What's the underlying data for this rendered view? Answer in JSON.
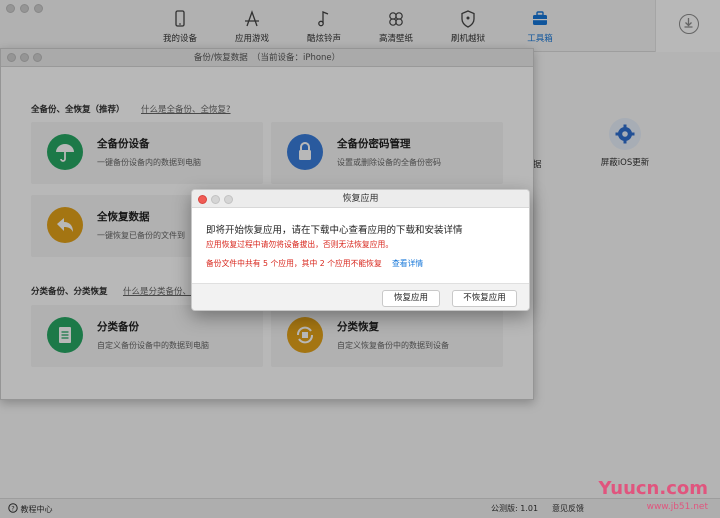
{
  "nav": {
    "tabs": [
      {
        "label": "我的设备",
        "icon": "phone-icon"
      },
      {
        "label": "应用游戏",
        "icon": "app-store-icon"
      },
      {
        "label": "酷炫铃声",
        "icon": "music-note-icon"
      },
      {
        "label": "高清壁纸",
        "icon": "flower-icon"
      },
      {
        "label": "刷机越狱",
        "icon": "shield-icon"
      },
      {
        "label": "工具箱",
        "icon": "toolbox-icon"
      }
    ],
    "active_index": 5,
    "download_icon": "download-icon"
  },
  "behind": {
    "ios_update_label": "屏蔽iOS更新",
    "partial_label": "据"
  },
  "backup_window": {
    "title": "备份/恢复数据　（当前设备：iPhone）",
    "section1": {
      "title": "全备份、全恢复（推荐）",
      "link": "什么是全备份、全恢复?"
    },
    "cards1": [
      {
        "title": "全备份设备",
        "desc": "一键备份设备内的数据到电脑",
        "icon": "umbrella-icon",
        "color": "#27a865"
      },
      {
        "title": "全备份密码管理",
        "desc": "设置或删除设备的全备份密码",
        "icon": "lock-icon",
        "color": "#3a7ddb"
      },
      {
        "title": "全恢复数据",
        "desc": "一键恢复已备份的文件到",
        "icon": "reply-arrow-icon",
        "color": "#e3a21a"
      }
    ],
    "section2": {
      "title": "分类备份、分类恢复",
      "link": "什么是分类备份、"
    },
    "cards2": [
      {
        "title": "分类备份",
        "desc": "自定义备份设备中的数据到电脑",
        "icon": "document-icon",
        "color": "#27a865"
      },
      {
        "title": "分类恢复",
        "desc": "自定义恢复备份中的数据到设备",
        "icon": "sync-icon",
        "color": "#e3a21a"
      }
    ]
  },
  "dialog": {
    "title": "恢复应用",
    "message": "即将开始恢复应用，请在下载中心查看应用的下载和安装详情",
    "warning": "应用恢复过程中请勿将设备拔出，否则无法恢复应用。",
    "count_text": "备份文件中共有 5 个应用，其中 2 个应用不能恢复",
    "details_link": "查看详情",
    "confirm_button": "恢复应用",
    "cancel_button": "不恢复应用",
    "colors": {
      "warning": "#d8261c",
      "link": "#1677d9"
    }
  },
  "status": {
    "tutorial": "教程中心",
    "version": "公测版: 1.01",
    "feedback": "意见反馈"
  },
  "watermark": {
    "brand": "Yuucn.com",
    "site": "www.jb51.net"
  }
}
